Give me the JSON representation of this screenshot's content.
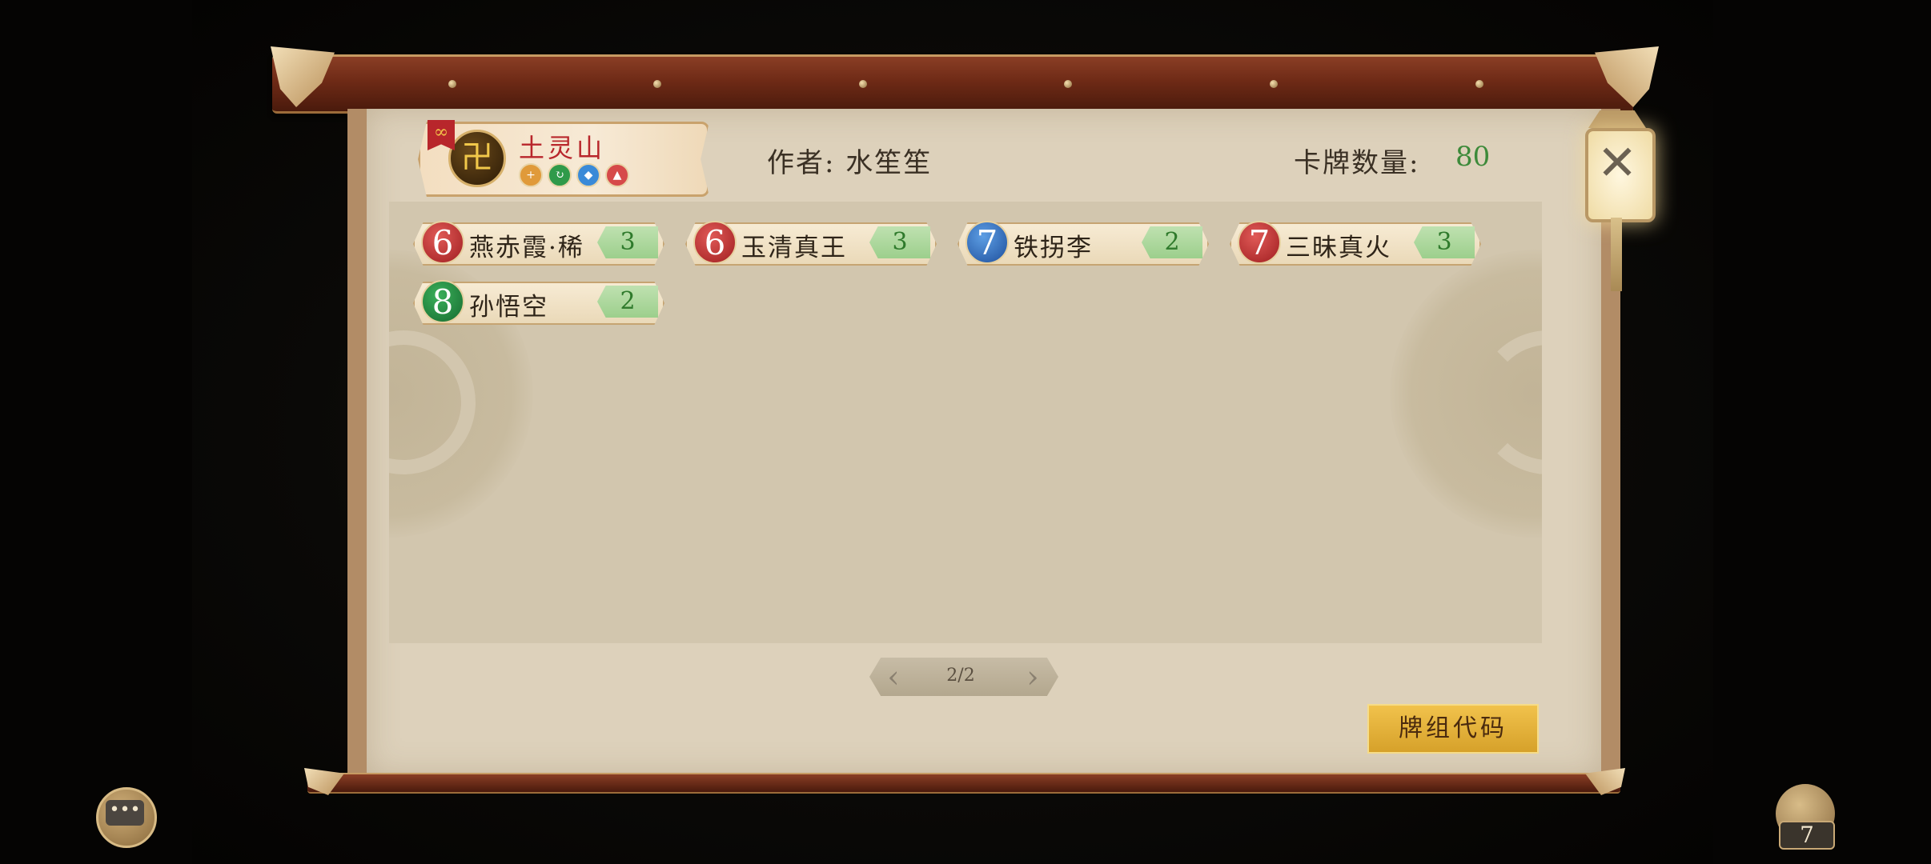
{
  "deck": {
    "name": "土灵山",
    "emblem": "卍",
    "link_icon": "link-icon",
    "element_icons": [
      "earth-icon",
      "wood-icon",
      "water-icon",
      "fire-icon"
    ],
    "element_colors": [
      "#e09a3a",
      "#2f9a4a",
      "#3a8ad8",
      "#d64a4a"
    ]
  },
  "header": {
    "author_label": "作者:",
    "author_name": "水笙笙",
    "count_label": "卡牌数量:",
    "count_value": "80"
  },
  "cards": [
    {
      "cost": "6",
      "name": "燕赤霞·稀",
      "qty": "3",
      "cost_color": "red"
    },
    {
      "cost": "6",
      "name": "玉清真王",
      "qty": "3",
      "cost_color": "red"
    },
    {
      "cost": "7",
      "name": "铁拐李",
      "qty": "2",
      "cost_color": "blue"
    },
    {
      "cost": "7",
      "name": "三昧真火",
      "qty": "3",
      "cost_color": "red"
    },
    {
      "cost": "8",
      "name": "孙悟空",
      "qty": "2",
      "cost_color": "green"
    }
  ],
  "pager": {
    "text": "2/2"
  },
  "buttons": {
    "deck_code": "牌组代码",
    "close": "✕"
  },
  "corner": {
    "chat_glyph": "•••",
    "bag_count": "7"
  }
}
